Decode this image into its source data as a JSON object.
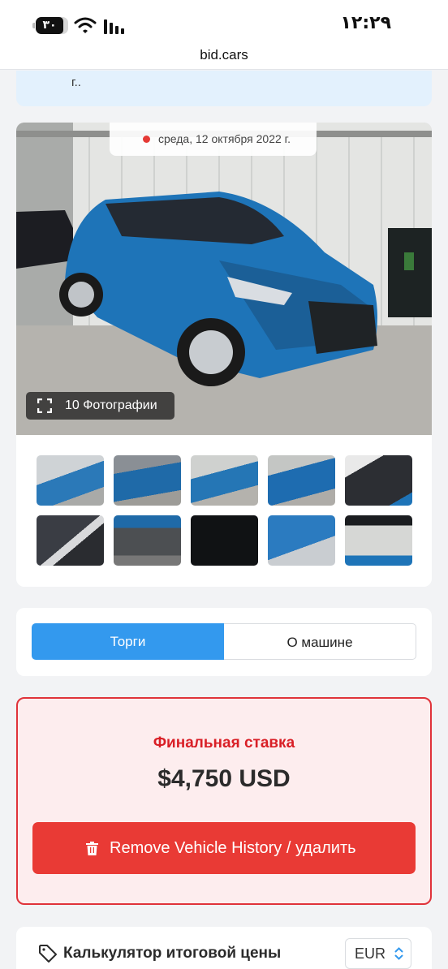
{
  "status_bar": {
    "time": "۱۲:۲۹",
    "battery": "۳۰"
  },
  "browser": {
    "url": "bid.cars"
  },
  "notice": {
    "text": "г.."
  },
  "gallery": {
    "date": "среда, 12 октября 2022 г.",
    "photos_button": "10 Фотографии",
    "thumbnail_count": 10
  },
  "tabs": {
    "active": "Торги",
    "inactive": "О машине"
  },
  "bid": {
    "title": "Финальная ставка",
    "amount": "$4,750 USD",
    "remove_button": "Remove Vehicle History / удалить"
  },
  "calculator": {
    "title": "Калькулятор итоговой цены",
    "currency": "EUR"
  },
  "colors": {
    "accent_blue": "#3399ee",
    "danger_red": "#e93a35",
    "bid_title_red": "#d91f26",
    "car_blue": "#1e74b8"
  }
}
